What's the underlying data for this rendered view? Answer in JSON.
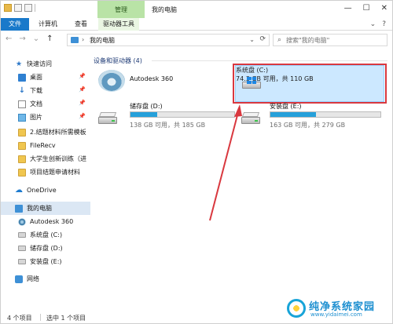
{
  "window": {
    "title": "我的电脑",
    "manage_tab": "管理",
    "controls": {
      "minimize": "—",
      "maximize": "☐",
      "close": "✕"
    }
  },
  "ribbon": {
    "file": "文件",
    "tabs": [
      "计算机",
      "查看",
      "驱动器工具"
    ],
    "expand_glyph": "⌄",
    "help_glyph": "?"
  },
  "address": {
    "back": "←",
    "forward": "→",
    "recent": "⌄",
    "up": "↑",
    "crumb_sep": "›",
    "crumb": "我的电脑",
    "dropdown": "⌄",
    "refresh": "⟳",
    "search_placeholder": "搜索\"我的电脑\""
  },
  "sidebar": {
    "items": [
      {
        "label": "快速访问",
        "icon": "star-icon"
      },
      {
        "label": "桌面",
        "icon": "desktop-icon",
        "pinned": true
      },
      {
        "label": "下载",
        "icon": "download-icon",
        "pinned": true
      },
      {
        "label": "文档",
        "icon": "document-icon",
        "pinned": true
      },
      {
        "label": "图片",
        "icon": "picture-icon",
        "pinned": true
      },
      {
        "label": "2.结题材料所需模板",
        "icon": "folder-icon"
      },
      {
        "label": "FileRecv",
        "icon": "folder-icon"
      },
      {
        "label": "大学生创新训练（进",
        "icon": "folder-icon"
      },
      {
        "label": "项目结题申请材料",
        "icon": "folder-icon"
      },
      {
        "label": "OneDrive",
        "icon": "onedrive-icon"
      },
      {
        "label": "我的电脑",
        "icon": "computer-icon",
        "selected": true
      },
      {
        "label": "Autodesk 360",
        "icon": "autodesk-icon"
      },
      {
        "label": "系统盘 (C:)",
        "icon": "drive-icon"
      },
      {
        "label": "储存盘 (D:)",
        "icon": "drive-icon"
      },
      {
        "label": "安装盘 (E:)",
        "icon": "drive-icon"
      },
      {
        "label": "网络",
        "icon": "network-icon"
      }
    ],
    "pin_glyph": "📌"
  },
  "content": {
    "group_header": "设备和驱动器 (4)",
    "autodesk": {
      "label": "Autodesk 360"
    },
    "drives": [
      {
        "name": "系统盘 (C:)",
        "info": "74.3 GB 可用，共 110 GB",
        "used_fraction": 0.325,
        "selected": true
      },
      {
        "name": "储存盘 (D:)",
        "info": "138 GB 可用，共 185 GB",
        "used_fraction": 0.254
      },
      {
        "name": "安装盘 (E:)",
        "info": "163 GB 可用，共 279 GB",
        "used_fraction": 0.416
      }
    ]
  },
  "status": {
    "items_count": "4 个项目",
    "selected": "选中 1 个项目"
  },
  "watermark": {
    "title": "纯净系统家园",
    "url": "www.yidaimei.com"
  },
  "colors": {
    "accent": "#26a0da",
    "file_tab": "#1979ca",
    "manage_tab": "#b9e3a6",
    "highlight_box": "#d9383f",
    "selected_tile": "#cce8ff"
  }
}
